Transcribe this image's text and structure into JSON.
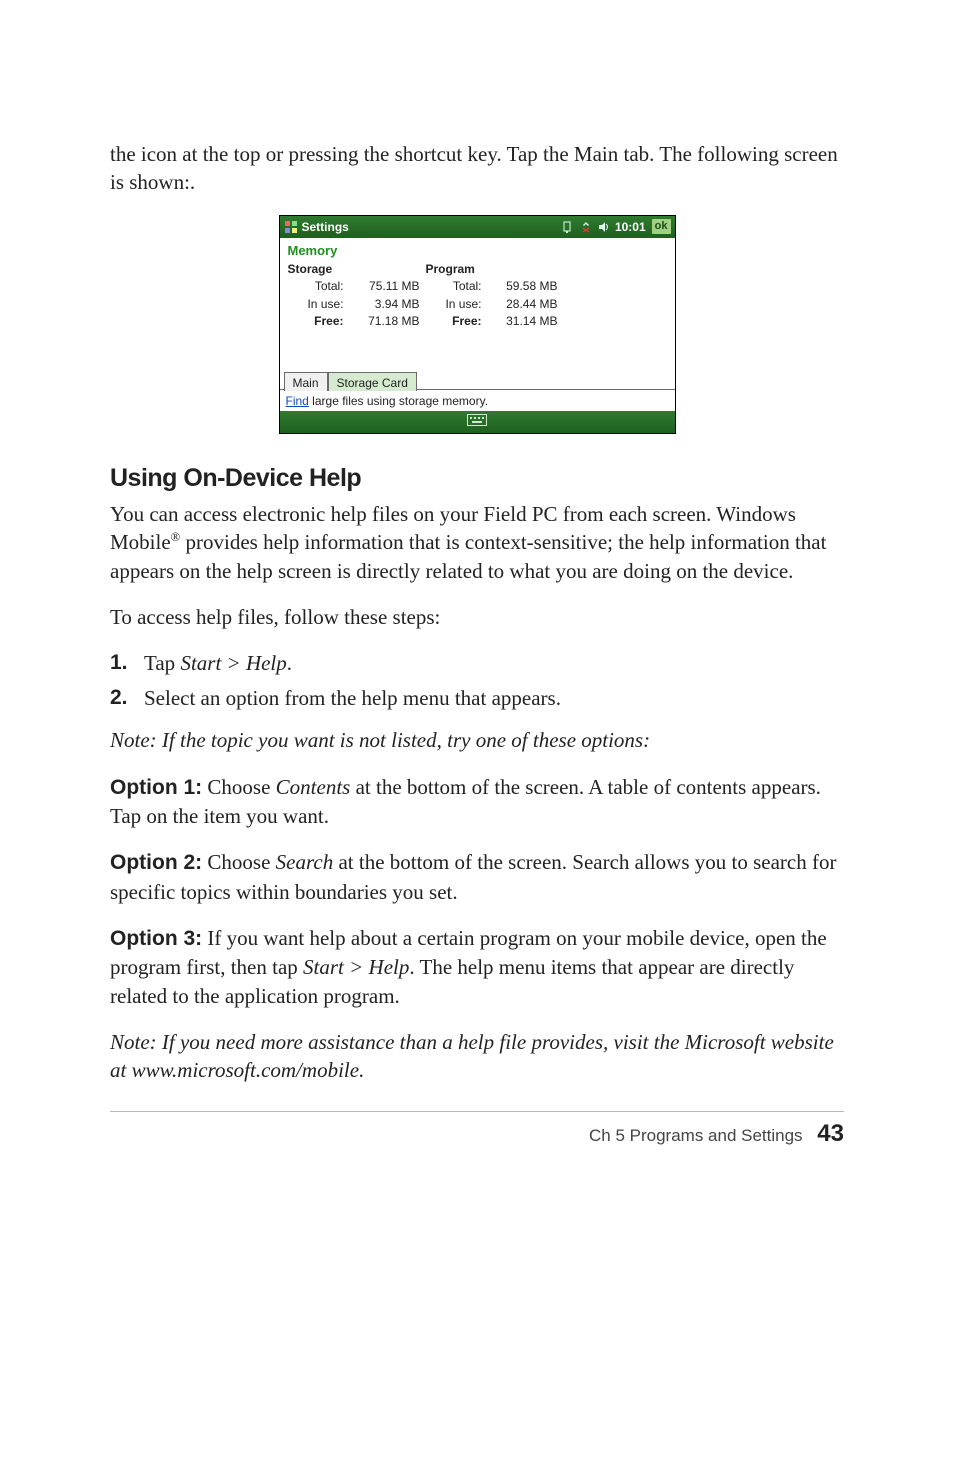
{
  "intro": {
    "para1": "the icon at the top or pressing the shortcut key. Tap the Main tab. The following screen is shown:."
  },
  "screenshot": {
    "titlebar": {
      "title": "Settings",
      "time": "10:01",
      "ok": "ok"
    },
    "subhead": "Memory",
    "storage": {
      "header": "Storage",
      "total_label": "Total:",
      "total_value": "75.11 MB",
      "inuse_label": "In use:",
      "inuse_value": "3.94 MB",
      "free_label": "Free:",
      "free_value": "71.18 MB"
    },
    "program": {
      "header": "Program",
      "total_label": "Total:",
      "total_value": "59.58 MB",
      "inuse_label": "In use:",
      "inuse_value": "28.44 MB",
      "free_label": "Free:",
      "free_value": "31.14 MB"
    },
    "tabs": {
      "main": "Main",
      "storage_card": "Storage Card"
    },
    "find_link": "Find",
    "find_rest": " large files using storage memory."
  },
  "section_heading": "Using On-Device Help",
  "body": {
    "para1a": "You can access electronic help files on your Field PC from each screen. Windows Mobile",
    "sup": "®",
    "para1b": " provides help information that is context-sensitive; the help information that appears on the help screen is directly related to what you are doing on the device.",
    "para2": "To access help files, follow these steps:",
    "step1_num": "1.",
    "step1_a": "Tap ",
    "step1_b": "Start > Help",
    "step1_c": ".",
    "step2_num": "2.",
    "step2": "Select an option from the help menu that appears.",
    "note1": "Note: If the topic you want is not listed, try one of these options:",
    "opt1_label": "Option 1:",
    "opt1_a": " Choose ",
    "opt1_b": "Contents",
    "opt1_c": " at the bottom of the screen. A table of contents appears. Tap on the item you want.",
    "opt2_label": "Option 2:",
    "opt2_a": " Choose ",
    "opt2_b": "Search",
    "opt2_c": " at the bottom of the screen. Search allows you to search for specific topics within boundaries you set.",
    "opt3_label": "Option 3:",
    "opt3_a": " If you want help about a certain program on your mobile device, open the program first, then tap ",
    "opt3_b": "Start > Help",
    "opt3_c": ". The help menu items that appear are directly related to the application program.",
    "note2": "Note: If you need more assistance than a help file provides, visit the Microsoft website at www.microsoft.com/mobile."
  },
  "footer": {
    "chapter": "Ch 5    Programs and Settings",
    "page": "43"
  }
}
